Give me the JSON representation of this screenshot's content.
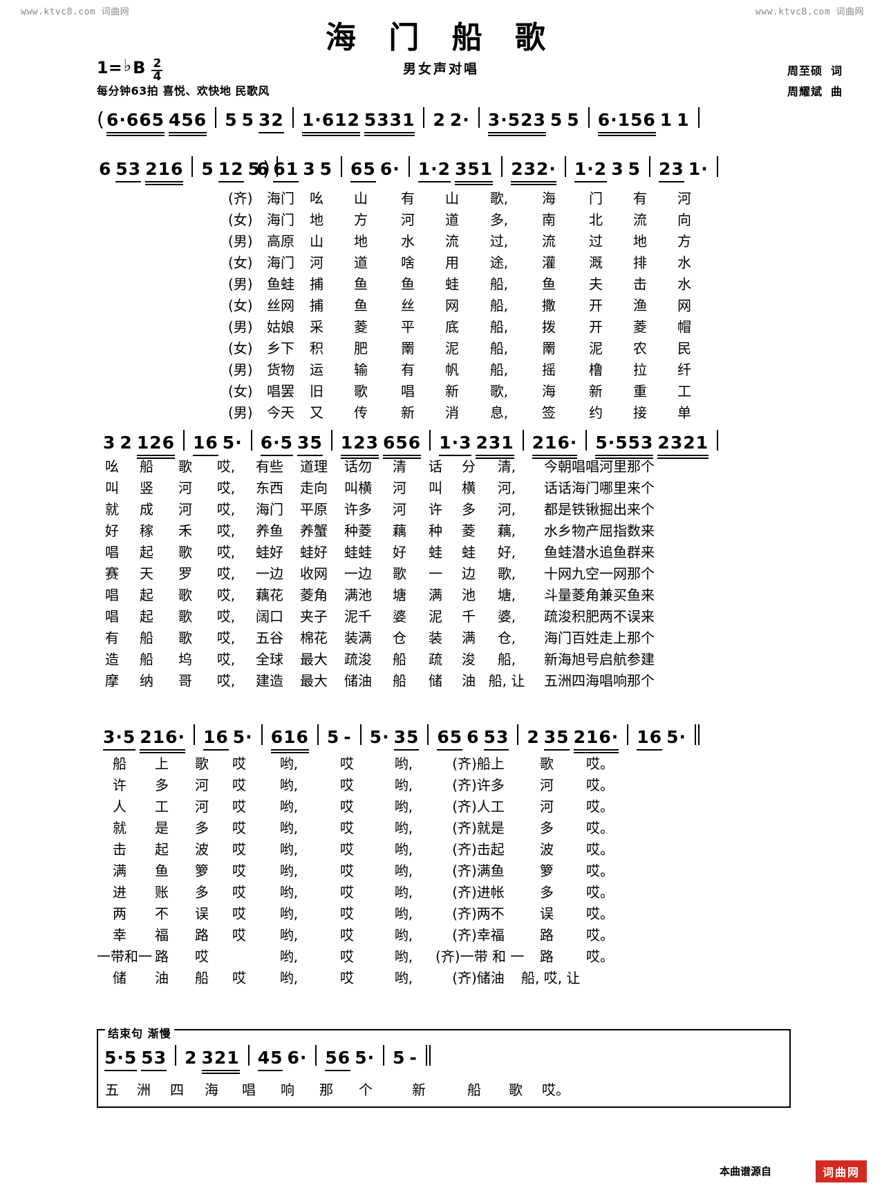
{
  "watermarks": {
    "left": "www.ktvc8.com  词曲网",
    "right": "www.ktvc8.com  词曲网"
  },
  "header": {
    "title": "海 门 船 歌",
    "subtitle": "男女声对唱",
    "key_label": "1=",
    "key_accidental": "♭",
    "key_note": "B",
    "meter_num": "2",
    "meter_den": "4",
    "tempo": "每分钟63拍 喜悦、欢快地 民歌风",
    "lyricist_name": "周至硕",
    "lyricist_role": "词",
    "composer_name": "周耀斌",
    "composer_role": "曲"
  },
  "staves": {
    "intro_line1": "( 6·665 456 | 5 5   32 | 1·612 5331 | 2 2· | 3·523 5 5 | 6·156 1 1 |",
    "intro_line2": "6 53 216 | 5  12 5 ) |",
    "verse_line1": "6 61 3 5 | 65 6· | 1·2 351 | 232· | 1·2 3 5 | 23 1· |",
    "chorus_line1": "3 2 126 | 16 5· | 6·5 35 | 123 656 | 1·3 231 | 216· | 5·553 2321 |",
    "ending_line1": "3·5 216· | 16 5· | 616 | 5 - | 5· 35 | 65 6 53 | 2 35 216· | 16 5· :|",
    "coda_line": "5·5 53 | 2 321 | 45 6· | 56 5· | 5 - ||"
  },
  "notation": {
    "line1": [
      {
        "t": "paren",
        "v": "("
      },
      {
        "t": "grp",
        "v": "6·665",
        "beam": 2,
        "dots": [
          0,
          0,
          1,
          0,
          0
        ]
      },
      {
        "t": "grp",
        "v": "456",
        "beam": 2,
        "dots": [
          0,
          0,
          0
        ]
      },
      {
        "t": "bar"
      },
      {
        "t": "grp",
        "v": "5",
        "beam": 1
      },
      {
        "t": "plain",
        "v": "5"
      },
      {
        "t": "sp"
      },
      {
        "t": "grp",
        "v": "32",
        "beam": 2
      },
      {
        "t": "bar"
      },
      {
        "t": "grp",
        "v": "1·612",
        "beam": 2
      },
      {
        "t": "grp",
        "v": "5331",
        "beam": 2
      },
      {
        "t": "bar"
      },
      {
        "t": "grp",
        "v": "2",
        "beam": 1
      },
      {
        "t": "plain",
        "v": "2·"
      },
      {
        "t": "bar"
      },
      {
        "t": "grp",
        "v": "3·523",
        "beam": 2
      },
      {
        "t": "grp",
        "v": "5 5",
        "beam": 1
      },
      {
        "t": "bar"
      },
      {
        "t": "grp",
        "v": "6·156",
        "beam": 2
      },
      {
        "t": "grp",
        "v": "1 1",
        "beam": 1
      },
      {
        "t": "bar"
      }
    ],
    "line2": [
      {
        "t": "grp",
        "v": "6",
        "beam": 1
      },
      {
        "t": "grp",
        "v": "53",
        "beam": 2
      },
      {
        "t": "grp",
        "v": "216",
        "beam": 2
      },
      {
        "t": "bar"
      },
      {
        "t": "plain",
        "v": "5"
      },
      {
        "t": "sup",
        "v": "12"
      },
      {
        "t": "plain",
        "v": "5 )"
      },
      {
        "t": "bar"
      }
    ]
  },
  "verse_block": {
    "columns": 11,
    "rows": [
      {
        "role": "(齐)",
        "cells": [
          "海门",
          "吆",
          "山",
          "有",
          "山",
          "歌,",
          "海",
          "门",
          "有",
          "河"
        ]
      },
      {
        "role": "(女)",
        "cells": [
          "海门",
          "地",
          "方",
          "河",
          "道",
          "多,",
          "南",
          "北",
          "流",
          "向"
        ]
      },
      {
        "role": "(男)",
        "cells": [
          "高原",
          "山",
          "地",
          "水",
          "流",
          "过,",
          "流",
          "过",
          "地",
          "方"
        ]
      },
      {
        "role": "(女)",
        "cells": [
          "海门",
          "河",
          "道",
          "啥",
          "用",
          "途,",
          "灌",
          "溉",
          "排",
          "水"
        ]
      },
      {
        "role": "(男)",
        "cells": [
          "鱼蛙",
          "捕",
          "鱼",
          "鱼",
          "蛙",
          "船,",
          "鱼",
          "夫",
          "击",
          "水"
        ]
      },
      {
        "role": "(女)",
        "cells": [
          "丝网",
          "捕",
          "鱼",
          "丝",
          "网",
          "船,",
          "撒",
          "开",
          "渔",
          "网"
        ]
      },
      {
        "role": "(男)",
        "cells": [
          "姑娘",
          "采",
          "菱",
          "平",
          "底",
          "船,",
          "拨",
          "开",
          "菱",
          "帽"
        ]
      },
      {
        "role": "(女)",
        "cells": [
          "乡下",
          "积",
          "肥",
          "罱",
          "泥",
          "船,",
          "罱",
          "泥",
          "农",
          "民"
        ]
      },
      {
        "role": "(男)",
        "cells": [
          "货物",
          "运",
          "输",
          "有",
          "帆",
          "船,",
          "摇",
          "橹",
          "拉",
          "纤"
        ]
      },
      {
        "role": "(女)",
        "cells": [
          "唱罢",
          "旧",
          "歌",
          "唱",
          "新",
          "歌,",
          "海",
          "新",
          "重",
          "工"
        ]
      },
      {
        "role": "(男)",
        "cells": [
          "今天",
          "又",
          "传",
          "新",
          "消",
          "息,",
          "签",
          "约",
          "接",
          "单"
        ]
      }
    ]
  },
  "chorus_block": {
    "rows": [
      {
        "cells": [
          "吆",
          "船",
          "歌",
          "哎,",
          "有些",
          "道理",
          "话勿",
          "清",
          "话",
          "分",
          "清,",
          "今朝唱唱河里那个"
        ]
      },
      {
        "cells": [
          "叫",
          "竖",
          "河",
          "哎,",
          "东西",
          "走向",
          "叫横",
          "河",
          "叫",
          "横",
          "河,",
          "话话海门哪里来个"
        ]
      },
      {
        "cells": [
          "就",
          "成",
          "河",
          "哎,",
          "海门",
          "平原",
          "许多",
          "河",
          "许",
          "多",
          "河,",
          "都是铁锹掘出来个"
        ]
      },
      {
        "cells": [
          "好",
          "稼",
          "禾",
          "哎,",
          "养鱼",
          "养蟹",
          "种菱",
          "藕",
          "种",
          "菱",
          "藕,",
          "水乡物产屈指数来"
        ]
      },
      {
        "cells": [
          "唱",
          "起",
          "歌",
          "哎,",
          "蛙好",
          "蛙好",
          "蛙蛙",
          "好",
          "蛙",
          "蛙",
          "好,",
          "鱼蛙潜水追鱼群来"
        ]
      },
      {
        "cells": [
          "赛",
          "天",
          "罗",
          "哎,",
          "一边",
          "收网",
          "一边",
          "歌",
          "一",
          "边",
          "歌,",
          "十网九空一网那个"
        ]
      },
      {
        "cells": [
          "唱",
          "起",
          "歌",
          "哎,",
          "藕花",
          "菱角",
          "满池",
          "塘",
          "满",
          "池",
          "塘,",
          "斗量菱角兼买鱼来"
        ]
      },
      {
        "cells": [
          "唱",
          "起",
          "歌",
          "哎,",
          "阔口",
          "夹子",
          "泥千",
          "婆",
          "泥",
          "千",
          "婆,",
          "疏浚积肥两不误来"
        ]
      },
      {
        "cells": [
          "有",
          "船",
          "歌",
          "哎,",
          "五谷",
          "棉花",
          "装满",
          "仓",
          "装",
          "满",
          "仓,",
          "海门百姓走上那个"
        ]
      },
      {
        "cells": [
          "造",
          "船",
          "坞",
          "哎,",
          "全球",
          "最大",
          "疏浚",
          "船",
          "疏",
          "浚",
          "船,",
          "新海旭号启航参建"
        ]
      },
      {
        "cells": [
          "摩",
          "纳",
          "哥",
          "哎,",
          "建造",
          "最大",
          "储油",
          "船",
          "储",
          "油",
          "船, 让",
          "五洲四海唱响那个"
        ]
      }
    ]
  },
  "ending_block": {
    "rows": [
      {
        "cells": [
          "船",
          "上",
          "歌",
          "哎",
          "哟,",
          "哎",
          "哟,",
          "(齐)船上",
          "歌",
          "哎。"
        ]
      },
      {
        "cells": [
          "许",
          "多",
          "河",
          "哎",
          "哟,",
          "哎",
          "哟,",
          "(齐)许多",
          "河",
          "哎。"
        ]
      },
      {
        "cells": [
          "人",
          "工",
          "河",
          "哎",
          "哟,",
          "哎",
          "哟,",
          "(齐)人工",
          "河",
          "哎。"
        ]
      },
      {
        "cells": [
          "就",
          "是",
          "多",
          "哎",
          "哟,",
          "哎",
          "哟,",
          "(齐)就是",
          "多",
          "哎。"
        ]
      },
      {
        "cells": [
          "击",
          "起",
          "波",
          "哎",
          "哟,",
          "哎",
          "哟,",
          "(齐)击起",
          "波",
          "哎。"
        ]
      },
      {
        "cells": [
          "满",
          "鱼",
          "箩",
          "哎",
          "哟,",
          "哎",
          "哟,",
          "(齐)满鱼",
          "箩",
          "哎。"
        ]
      },
      {
        "cells": [
          "进",
          "账",
          "多",
          "哎",
          "哟,",
          "哎",
          "哟,",
          "(齐)进帐",
          "多",
          "哎。"
        ]
      },
      {
        "cells": [
          "两",
          "不",
          "误",
          "哎",
          "哟,",
          "哎",
          "哟,",
          "(齐)两不",
          "误",
          "哎。"
        ]
      },
      {
        "cells": [
          "幸",
          "福",
          "路",
          "哎",
          "哟,",
          "哎",
          "哟,",
          "(齐)幸福",
          "路",
          "哎。"
        ]
      },
      {
        "cells": [
          "一带和一",
          "路",
          "哎",
          "",
          "哟,",
          "哎",
          "哟,",
          "(齐)一带 和 一",
          "路",
          "哎。"
        ]
      },
      {
        "cells": [
          "储",
          "油",
          "船",
          "哎",
          "哟,",
          "哎",
          "哟,",
          "(齐)储油",
          "船, 哎, 让"
        ]
      }
    ]
  },
  "coda": {
    "label": "结束句  渐慢",
    "lyrics": [
      "五",
      "洲",
      "四",
      "海",
      "唱",
      "响",
      "那",
      "个",
      "新",
      "船",
      "歌",
      "哎。"
    ]
  },
  "footer": {
    "source_note": "本曲谱源自",
    "brand": "词曲网"
  }
}
